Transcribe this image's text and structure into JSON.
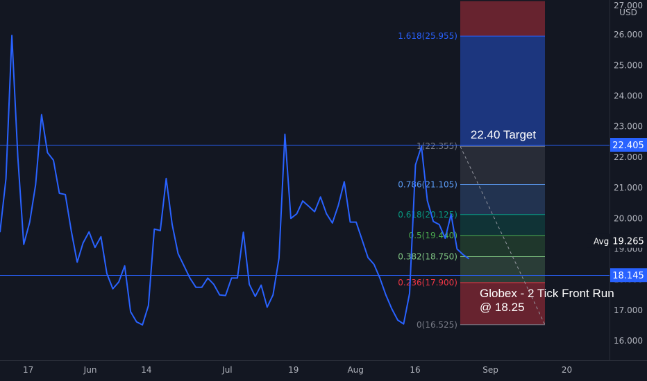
{
  "chart_data": {
    "type": "line",
    "currency": "USD",
    "y_ticks": [
      "27.000",
      "26.000",
      "25.000",
      "24.000",
      "23.000",
      "22.000",
      "21.000",
      "20.000",
      "19.000",
      "18.000",
      "17.000",
      "16.000"
    ],
    "y_tick_values": [
      27,
      26,
      25,
      24,
      23,
      22,
      21,
      20,
      19,
      18,
      17,
      16
    ],
    "ylim": [
      15.55,
      27.1
    ],
    "x_ticks": [
      {
        "label": "17",
        "idx": 3
      },
      {
        "label": "Jun",
        "idx": 11
      },
      {
        "label": "14",
        "idx": 18
      },
      {
        "label": "Jul",
        "idx": 28
      },
      {
        "label": "19",
        "idx": 36
      },
      {
        "label": "Aug",
        "idx": 44
      },
      {
        "label": "16",
        "idx": 51
      },
      {
        "label": "Sep",
        "idx": 61
      },
      {
        "label": "20",
        "idx": 70
      }
    ],
    "xlim": [
      0,
      80
    ],
    "grid": false,
    "series": [
      {
        "color": "#2962ff",
        "values": [
          19.55,
          21.3,
          25.98,
          22.0,
          19.15,
          19.88,
          21.1,
          23.39,
          22.15,
          21.9,
          20.82,
          20.78,
          19.6,
          18.57,
          19.2,
          19.56,
          19.05,
          19.4,
          18.2,
          17.7,
          17.92,
          18.45,
          16.95,
          16.62,
          16.52,
          17.15,
          19.65,
          19.6,
          21.3,
          19.8,
          18.85,
          18.45,
          18.05,
          17.75,
          17.75,
          18.05,
          17.85,
          17.5,
          17.48,
          18.05,
          18.05,
          19.55,
          17.85,
          17.45,
          17.82,
          17.1,
          17.5,
          18.7,
          22.75,
          20.0,
          20.15,
          20.57,
          20.4,
          20.22,
          20.7,
          20.15,
          19.85,
          20.43,
          21.2,
          19.88,
          19.88,
          19.3,
          18.72,
          18.5,
          18.05,
          17.5,
          17.05,
          16.68,
          16.55,
          17.55,
          21.75,
          22.35,
          20.58,
          19.9,
          19.8,
          19.35,
          20.13,
          19.0,
          18.82,
          18.68
        ],
        "x_positions": [
          0,
          1,
          2,
          3,
          4,
          5,
          6,
          7,
          8,
          9,
          10,
          11,
          12,
          13,
          14,
          15,
          16,
          17,
          18,
          19,
          20,
          21,
          22,
          23,
          24,
          25,
          26,
          27,
          28,
          29,
          30,
          31,
          32,
          33,
          34,
          35,
          36,
          37,
          38,
          39,
          40,
          41,
          42,
          43,
          44,
          45,
          46,
          47,
          48,
          49,
          50,
          51,
          52,
          53,
          54,
          55,
          56,
          57,
          58,
          59,
          60,
          61,
          62,
          63,
          64,
          65,
          66,
          67,
          68,
          69,
          70,
          71,
          72,
          73,
          74,
          75,
          76,
          77,
          78,
          79
        ]
      }
    ],
    "horizontal_lines": [
      {
        "price": 22.405,
        "label": "22.405",
        "color": "#2962ff"
      },
      {
        "price": 18.145,
        "label": "18.145",
        "color": "#2962ff"
      }
    ],
    "avg": {
      "label": "Avg",
      "price_label": "19.265",
      "price": 19.265
    },
    "fib_levels": [
      {
        "ratio_label": "1.618(25.955)",
        "price": 25.955,
        "color": "#2962ff"
      },
      {
        "ratio_label": "1(22.355)",
        "price": 22.355,
        "color": "#787b86"
      },
      {
        "ratio_label": "0.786(21.105)",
        "price": 21.105,
        "color": "#5b9cf6"
      },
      {
        "ratio_label": "0.618(20.125)",
        "price": 20.125,
        "color": "#089981"
      },
      {
        "ratio_label": "0.5(19.440)",
        "price": 19.44,
        "color": "#4caf50"
      },
      {
        "ratio_label": "0.382(18.750)",
        "price": 18.75,
        "color": "#81c784"
      },
      {
        "ratio_label": "0.236(17.900)",
        "price": 17.9,
        "color": "#f23645"
      },
      {
        "ratio_label": "0(16.525)",
        "price": 16.525,
        "color": "#787b86"
      }
    ],
    "fib_zones": [
      {
        "from": 27.1,
        "to": 25.955,
        "color": "#f23645"
      },
      {
        "from": 25.955,
        "to": 22.355,
        "color": "#2962ff"
      },
      {
        "from": 22.355,
        "to": 21.105,
        "color": "#787b86"
      },
      {
        "from": 21.105,
        "to": 20.125,
        "color": "#5b9cf6"
      },
      {
        "from": 20.125,
        "to": 19.44,
        "color": "#089981"
      },
      {
        "from": 19.44,
        "to": 18.75,
        "color": "#4caf50"
      },
      {
        "from": 18.75,
        "to": 17.9,
        "color": "#81c784"
      },
      {
        "from": 17.9,
        "to": 16.525,
        "color": "#f23645"
      }
    ],
    "fib_x_range": [
      59,
      70
    ],
    "annotations": [
      {
        "text": "22.40 Target",
        "lines": [
          "22.40 Target"
        ]
      },
      {
        "text": "Globex - 2 Tick Front Run @ 18.25",
        "lines": [
          "Globex - 2 Tick Front Run",
          "@ 18.25"
        ]
      }
    ],
    "colors": {
      "background": "#131722",
      "line": "#2962ff",
      "text": "#b2b5be",
      "axis_border": "#2a2e39",
      "label_bg": "#2962ff",
      "avg_bg": "#131722"
    }
  }
}
